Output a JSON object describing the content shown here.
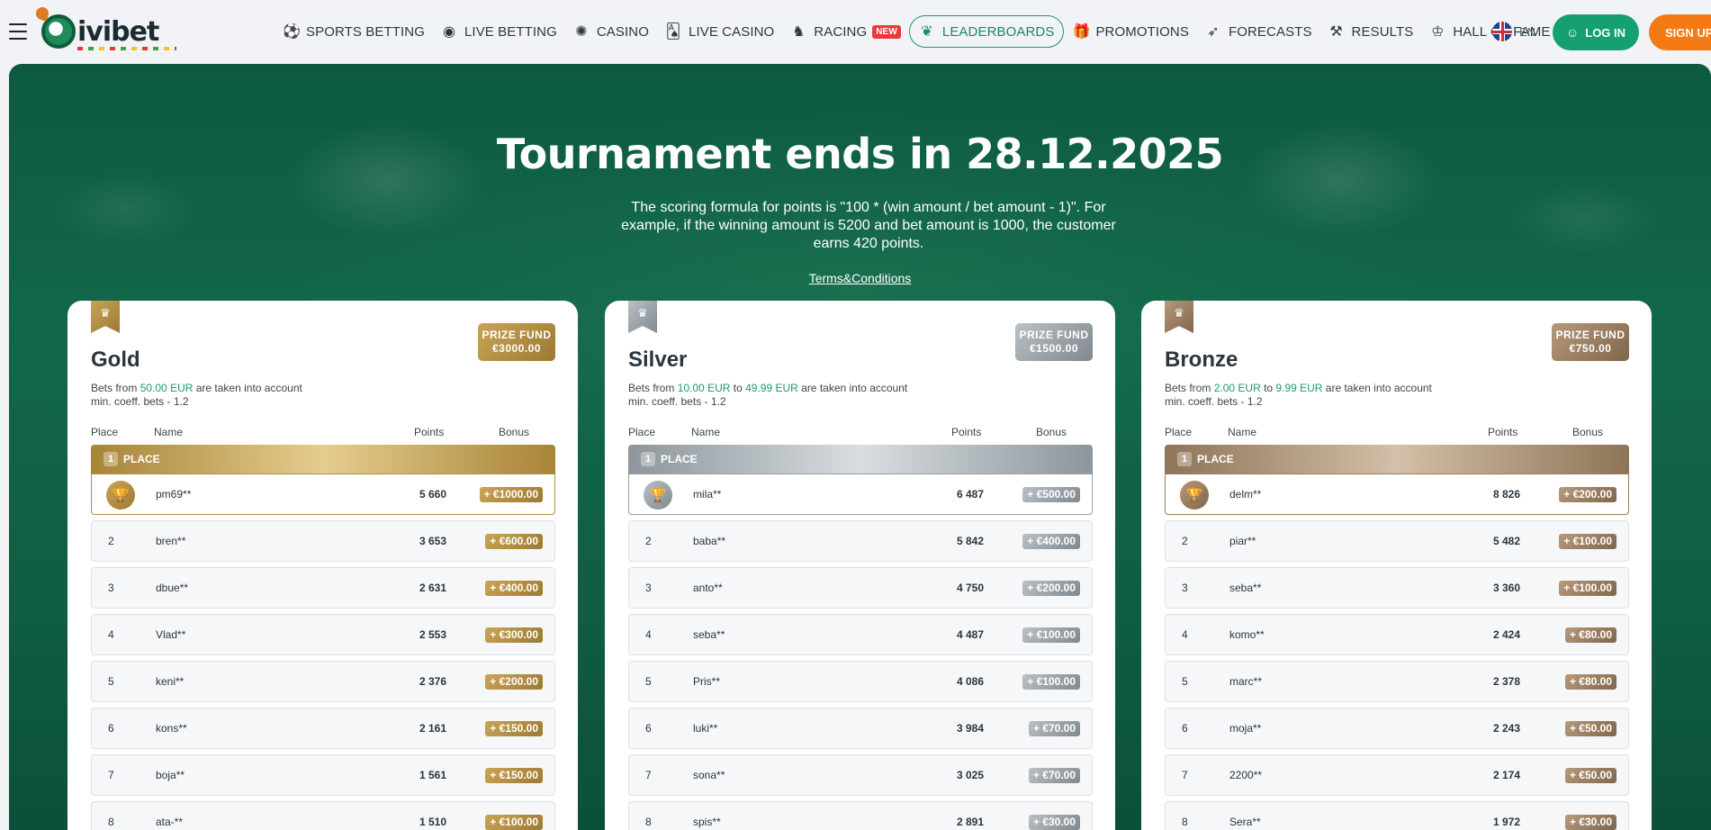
{
  "header": {
    "logo_text": "ivibet",
    "nav": [
      {
        "label": "SPORTS BETTING",
        "icon": "soccer-ball-icon",
        "glyph": "⚽"
      },
      {
        "label": "LIVE BETTING",
        "icon": "live-ball-icon",
        "glyph": "◉"
      },
      {
        "label": "CASINO",
        "icon": "roulette-icon",
        "glyph": "✺"
      },
      {
        "label": "LIVE CASINO",
        "icon": "cards-icon",
        "glyph": "🂡"
      },
      {
        "label": "RACING",
        "icon": "horse-icon",
        "glyph": "♞",
        "badge": "NEW"
      },
      {
        "label": "LEADERBOARDS",
        "icon": "laurel-icon",
        "glyph": "❦"
      },
      {
        "label": "PROMOTIONS",
        "icon": "gift-icon",
        "glyph": "🎁"
      },
      {
        "label": "FORECASTS",
        "icon": "cursor-icon",
        "glyph": "➶"
      },
      {
        "label": "RESULTS",
        "icon": "hammers-icon",
        "glyph": "⚒"
      },
      {
        "label": "HALL OF FAME",
        "icon": "podium-icon",
        "glyph": "♔"
      }
    ],
    "lang": "EN",
    "login_label": "LOG IN",
    "signup_label": "SIGN UP"
  },
  "hero": {
    "title": "Tournament ends in 28.12.2025",
    "description": "The scoring formula for points is \"100 * (win amount / bet amount - 1)\". For example, if the winning amount is 5200 and bet amount is 1000, the customer earns 420 points.",
    "terms_label": "Terms&Conditions"
  },
  "table_headers": {
    "place": "Place",
    "name": "Name",
    "points": "Points",
    "bonus": "Bonus"
  },
  "first_place_label": "PLACE",
  "tiers": [
    {
      "title": "Gold",
      "prize_label": "PRIZE FUND",
      "prize_amount": "€3000.00",
      "bets_prefix": "Bets from",
      "bets_from": "50.00 EUR",
      "bets_to": "",
      "bets_suffix": "are taken into account",
      "coeff": "min. coeff. bets - 1.2",
      "rows": [
        {
          "place": "1",
          "name": "pm69**",
          "points": "5 660",
          "bonus": "+ €1000.00"
        },
        {
          "place": "2",
          "name": "bren**",
          "points": "3 653",
          "bonus": "+ €600.00"
        },
        {
          "place": "3",
          "name": "dbue**",
          "points": "2 631",
          "bonus": "+ €400.00"
        },
        {
          "place": "4",
          "name": "Vlad**",
          "points": "2 553",
          "bonus": "+ €300.00"
        },
        {
          "place": "5",
          "name": "keni**",
          "points": "2 376",
          "bonus": "+ €200.00"
        },
        {
          "place": "6",
          "name": "kons**",
          "points": "2 161",
          "bonus": "+ €150.00"
        },
        {
          "place": "7",
          "name": "boja**",
          "points": "1 561",
          "bonus": "+ €150.00"
        },
        {
          "place": "8",
          "name": "ata-**",
          "points": "1 510",
          "bonus": "+ €100.00"
        }
      ]
    },
    {
      "title": "Silver",
      "prize_label": "PRIZE FUND",
      "prize_amount": "€1500.00",
      "bets_prefix": "Bets from",
      "bets_from": "10.00 EUR",
      "bets_to": "49.99 EUR",
      "bets_suffix": "are taken into account",
      "coeff": "min. coeff. bets - 1.2",
      "rows": [
        {
          "place": "1",
          "name": "mila**",
          "points": "6 487",
          "bonus": "+ €500.00"
        },
        {
          "place": "2",
          "name": "baba**",
          "points": "5 842",
          "bonus": "+ €400.00"
        },
        {
          "place": "3",
          "name": "anto**",
          "points": "4 750",
          "bonus": "+ €200.00"
        },
        {
          "place": "4",
          "name": "seba**",
          "points": "4 487",
          "bonus": "+ €100.00"
        },
        {
          "place": "5",
          "name": "Pris**",
          "points": "4 086",
          "bonus": "+ €100.00"
        },
        {
          "place": "6",
          "name": "luki**",
          "points": "3 984",
          "bonus": "+ €70.00"
        },
        {
          "place": "7",
          "name": "sona**",
          "points": "3 025",
          "bonus": "+ €70.00"
        },
        {
          "place": "8",
          "name": "spis**",
          "points": "2 891",
          "bonus": "+ €30.00"
        }
      ]
    },
    {
      "title": "Bronze",
      "prize_label": "PRIZE FUND",
      "prize_amount": "€750.00",
      "bets_prefix": "Bets from",
      "bets_from": "2.00 EUR",
      "bets_to": "9.99 EUR",
      "bets_suffix": "are taken into account",
      "coeff": "min. coeff. bets - 1.2",
      "rows": [
        {
          "place": "1",
          "name": "delm**",
          "points": "8 826",
          "bonus": "+ €200.00"
        },
        {
          "place": "2",
          "name": "piar**",
          "points": "5 482",
          "bonus": "+ €100.00"
        },
        {
          "place": "3",
          "name": "seba**",
          "points": "3 360",
          "bonus": "+ €100.00"
        },
        {
          "place": "4",
          "name": "komo**",
          "points": "2 424",
          "bonus": "+ €80.00"
        },
        {
          "place": "5",
          "name": "marc**",
          "points": "2 378",
          "bonus": "+ €80.00"
        },
        {
          "place": "6",
          "name": "moja**",
          "points": "2 243",
          "bonus": "+ €50.00"
        },
        {
          "place": "7",
          "name": "2200**",
          "points": "2 174",
          "bonus": "+ €50.00"
        },
        {
          "place": "8",
          "name": "Sera**",
          "points": "1 972",
          "bonus": "+ €30.00"
        }
      ]
    }
  ]
}
